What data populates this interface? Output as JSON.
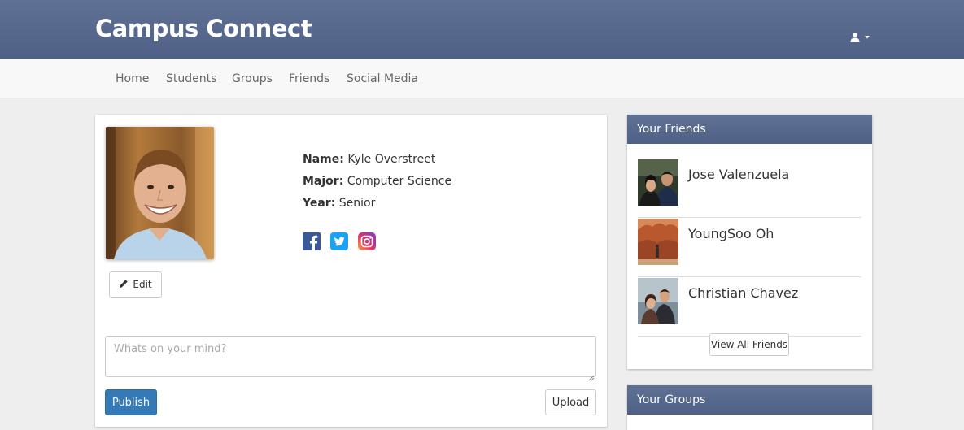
{
  "header": {
    "brand": "Campus Connect",
    "user_menu_icon": "user-icon",
    "caret_icon": "caret-down-icon"
  },
  "nav": {
    "items": [
      "Home",
      "Students",
      "Groups",
      "Friends",
      "Social Media"
    ]
  },
  "profile": {
    "photo_alt": "profile-photo",
    "edit_label": "Edit",
    "fields": [
      {
        "label": "Name:",
        "value": "Kyle Overstreet"
      },
      {
        "label": "Major:",
        "value": "Computer Science"
      },
      {
        "label": "Year:",
        "value": "Senior"
      }
    ],
    "social_icons": [
      "facebook-icon",
      "twitter-icon",
      "instagram-icon"
    ]
  },
  "post": {
    "placeholder": "Whats on your mind?",
    "publish_label": "Publish",
    "upload_label": "Upload"
  },
  "friends_panel": {
    "title": "Your Friends",
    "friends": [
      {
        "name": "Jose Valenzuela"
      },
      {
        "name": "YoungSoo Oh"
      },
      {
        "name": "Christian Chavez"
      }
    ],
    "view_all_label": "View All Friends"
  },
  "groups_panel": {
    "title": "Your Groups"
  },
  "colors": {
    "header_bar": "#56688c",
    "primary_button": "#337ab7",
    "facebook": "#3b5998",
    "twitter": "#1da1f2"
  }
}
